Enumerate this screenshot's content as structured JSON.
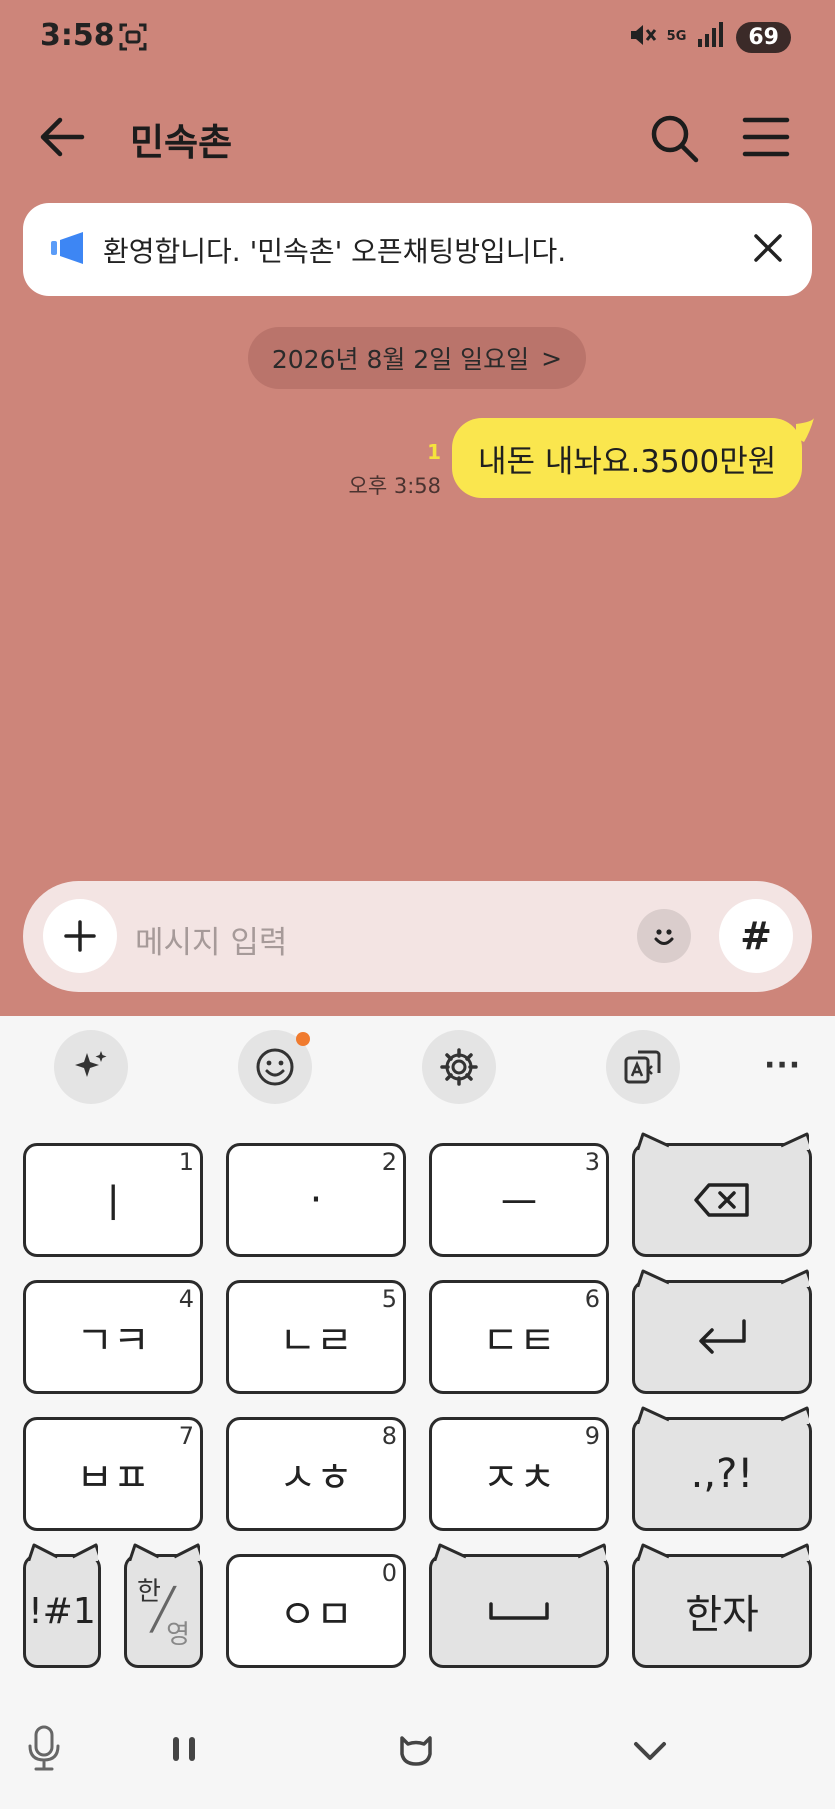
{
  "status_bar": {
    "time": "3:58",
    "network": "5G",
    "battery": "69"
  },
  "header": {
    "title": "민속촌"
  },
  "notice": {
    "text": "환영합니다. '민속촌' 오픈채팅방입니다."
  },
  "date_divider": {
    "label": "2026년 8월 2일 일요일",
    "chevron": ">"
  },
  "messages": [
    {
      "text": "내돈 내놔요.3500만원",
      "time": "오후 3:58",
      "unread": "1"
    }
  ],
  "input": {
    "placeholder": "메시지 입력",
    "hash_label": "#"
  },
  "keyboard": {
    "toolbar_more": "···",
    "keys": [
      {
        "label": "ㅣ",
        "num": "1"
      },
      {
        "label": "·",
        "num": "2"
      },
      {
        "label": "ㅡ",
        "num": "3"
      },
      {
        "label": "ㄱㅋ",
        "num": "4"
      },
      {
        "label": "ㄴㄹ",
        "num": "5"
      },
      {
        "label": "ㄷㅌ",
        "num": "6"
      },
      {
        "label": "ㅂㅍ",
        "num": "7"
      },
      {
        "label": "ㅅㅎ",
        "num": "8"
      },
      {
        "label": "ㅈㅊ",
        "num": "9"
      },
      {
        "label": "ㅇㅁ",
        "num": "0"
      }
    ],
    "punct": ".,?!",
    "symbols": "!#1",
    "lang_top": "한",
    "lang_bottom": "영",
    "hanja": "한자"
  }
}
